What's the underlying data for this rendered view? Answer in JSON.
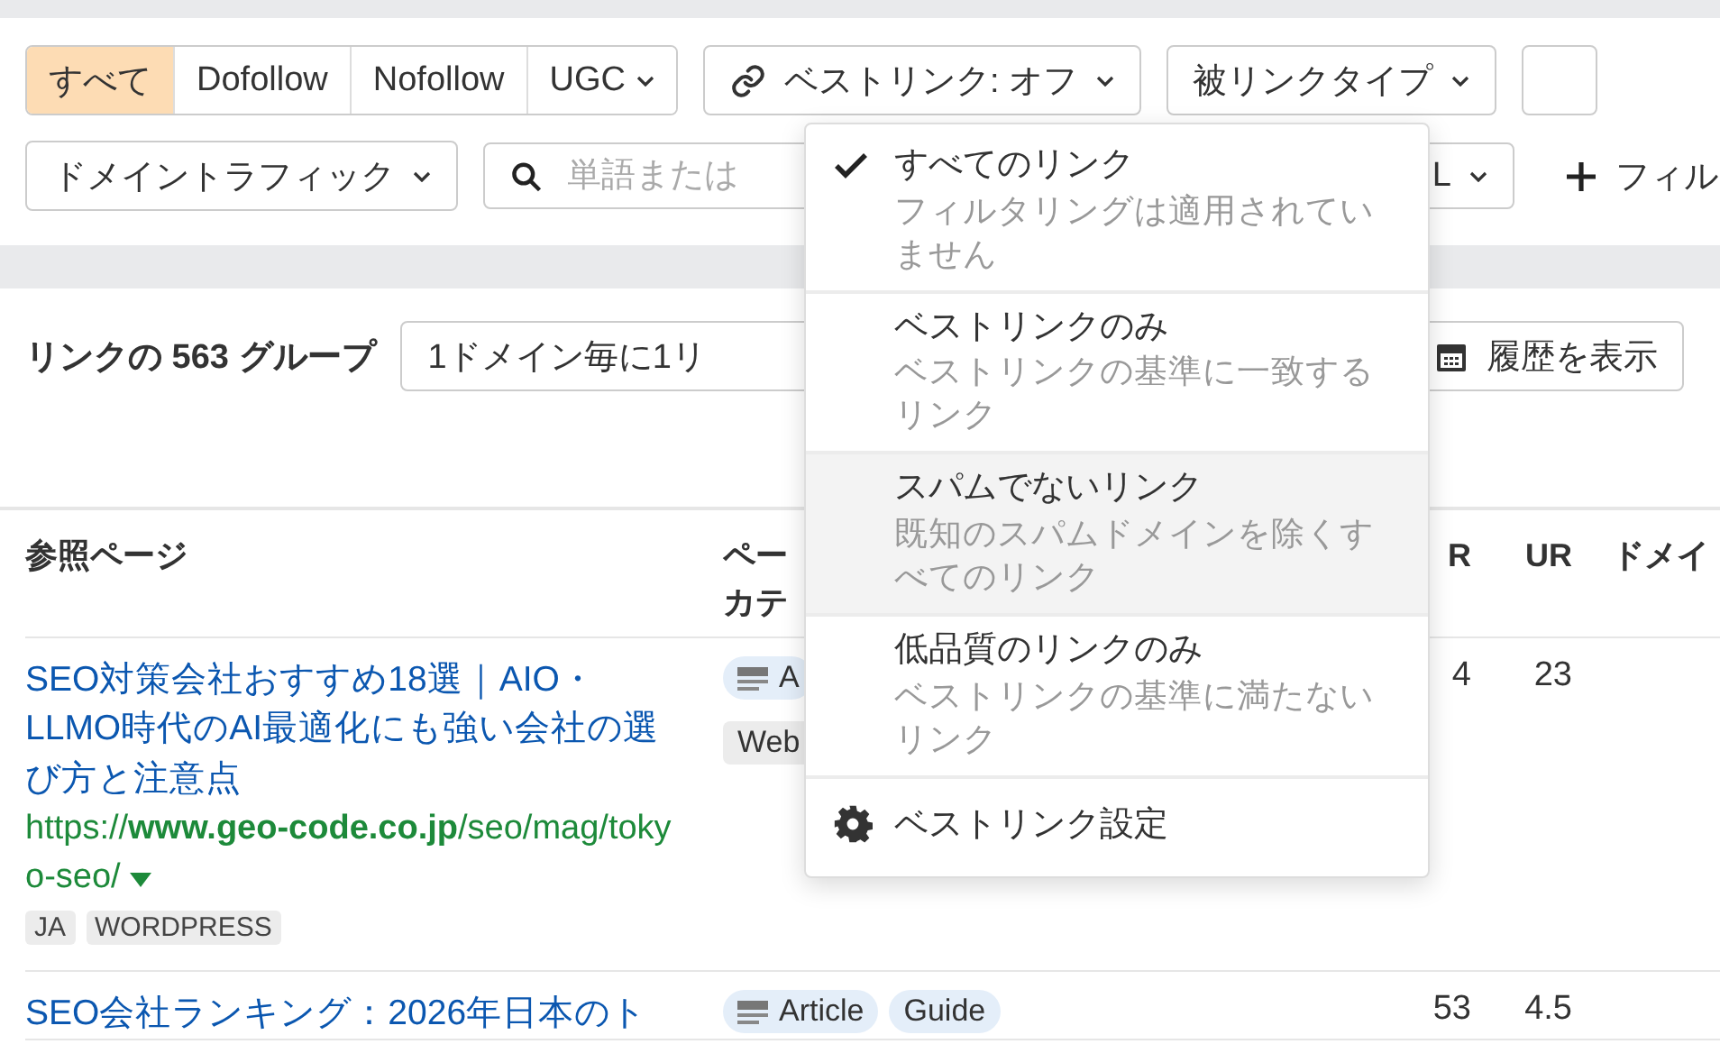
{
  "link_type_filter": [
    {
      "label": "すべて",
      "selected": true,
      "caret": false
    },
    {
      "label": "Dofollow",
      "selected": false,
      "caret": false
    },
    {
      "label": "Nofollow",
      "selected": false,
      "caret": false
    },
    {
      "label": "UGC",
      "selected": false,
      "caret": true
    }
  ],
  "best_links_button": {
    "label": "ベストリンク: オフ"
  },
  "backlink_type_button": {
    "label": "被リンクタイプ"
  },
  "domain_traffic_button": {
    "label": "ドメイントラフィック"
  },
  "search": {
    "placeholder": "単語または"
  },
  "partial_filter_button": {
    "label": "L"
  },
  "add_filter": {
    "label": "フィル"
  },
  "summary": {
    "title": "リンクの 563 グループ",
    "grouping_select": "1ドメイン毎に1リ",
    "history_button": "履歴を表示"
  },
  "table": {
    "columns": [
      [
        "参照ページ"
      ],
      [
        "ペー",
        "カテ"
      ],
      [
        "R"
      ],
      [
        "UR"
      ],
      [
        "ドメイ"
      ]
    ],
    "rows": [
      {
        "title": "SEO対策会社おすすめ18選｜AIO・LLMO時代のAI最適化にも強い会社の選び方と注意点",
        "url": "https://**www.geo-code.co.jp**/seo/mag/tokyo-seo/",
        "tags": [
          "JA",
          "WORDPRESS"
        ],
        "categories": [
          {
            "label": "A",
            "kind": "type"
          },
          {
            "label": "Web",
            "kind": "topic"
          }
        ],
        "dr": "4",
        "ur": "23"
      },
      {
        "title": "SEO会社ランキング：2026年日本のト",
        "categories": [
          {
            "label": "Article",
            "kind": "type"
          },
          {
            "label": "Guide",
            "kind": "type"
          }
        ],
        "dr": "53",
        "ur": "4.5"
      }
    ]
  },
  "best_links_menu": {
    "items": [
      {
        "title": "すべてのリンク",
        "subtitle": "フィルタリングは適用されていません",
        "selected": true,
        "highlighted": false
      },
      {
        "title": "ベストリンクのみ",
        "subtitle": "ベストリンクの基準に一致するリンク",
        "selected": false,
        "highlighted": false
      },
      {
        "title": "スパムでないリンク",
        "subtitle": "既知のスパムドメインを除くすべてのリンク",
        "selected": false,
        "highlighted": true
      },
      {
        "title": "低品質のリンクのみ",
        "subtitle": "ベストリンクの基準に満たないリンク",
        "selected": false,
        "highlighted": false
      }
    ],
    "settings": "ベストリンク設定"
  }
}
